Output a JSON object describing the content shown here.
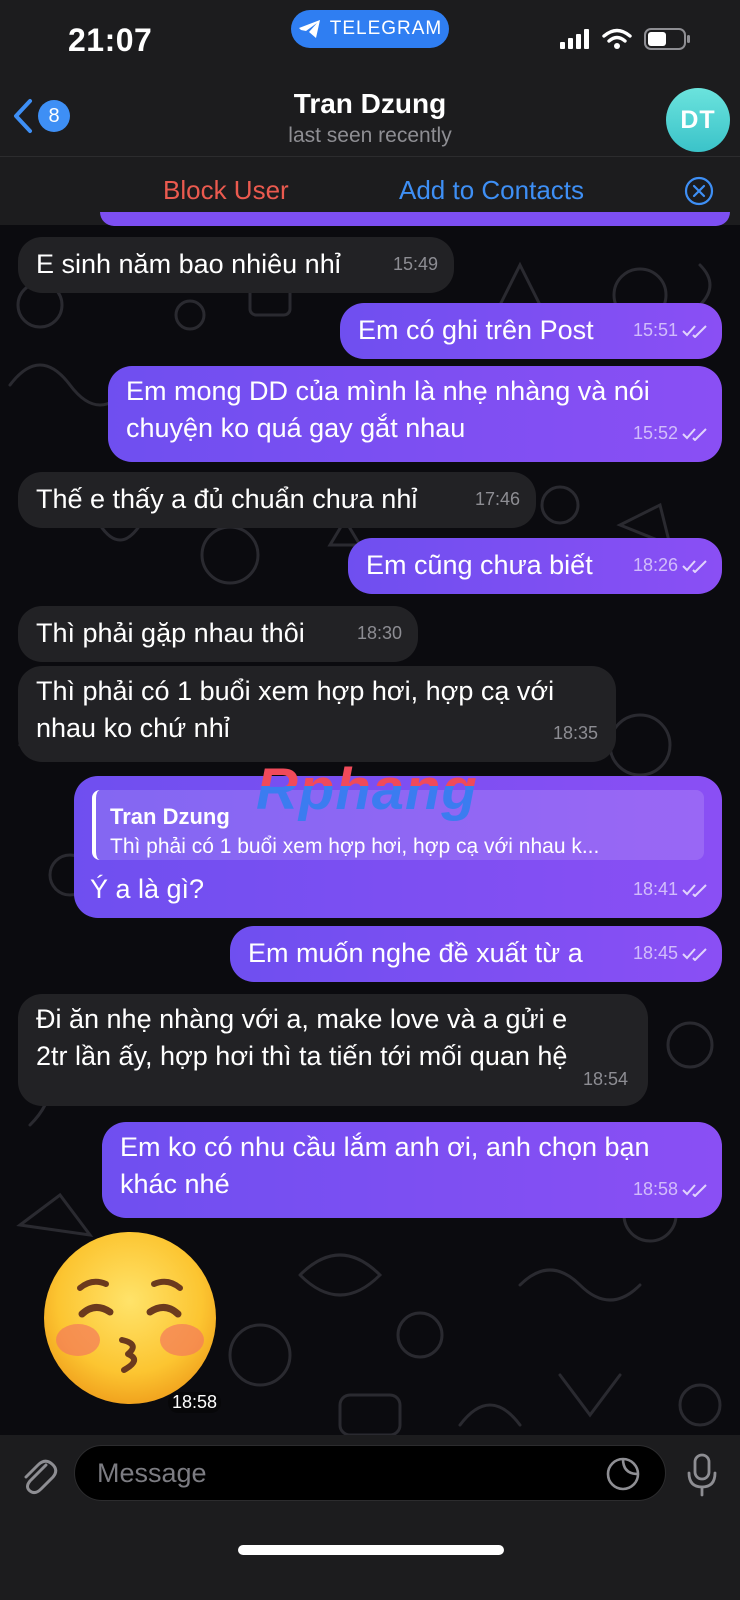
{
  "status_bar": {
    "time": "21:07",
    "pill_label": "TELEGRAM"
  },
  "header": {
    "back_badge": "8",
    "title": "Tran Dzung",
    "subtitle": "last seen recently",
    "avatar_initials": "DT"
  },
  "action_bar": {
    "block_label": "Block User",
    "add_label": "Add to Contacts"
  },
  "messages": [
    {
      "dir": "in",
      "lines": [
        "E sinh năm bao nhiêu nhỉ"
      ],
      "time": "15:49"
    },
    {
      "dir": "out",
      "lines": [
        "Em có ghi trên Post"
      ],
      "time": "15:51"
    },
    {
      "dir": "out",
      "lines": [
        "Em mong DD của mình là nhẹ nhàng và nói",
        "chuyện ko quá gay gắt nhau"
      ],
      "time": "15:52"
    },
    {
      "dir": "in",
      "lines": [
        "Thế e thấy a đủ chuẩn chưa nhỉ"
      ],
      "time": "17:46"
    },
    {
      "dir": "out",
      "lines": [
        "Em cũng chưa biết"
      ],
      "time": "18:26"
    },
    {
      "dir": "in",
      "lines": [
        "Thì phải gặp nhau thôi"
      ],
      "time": "18:30"
    },
    {
      "dir": "in",
      "lines": [
        "Thì phải có 1 buổi xem hợp hơi, hợp cạ với",
        "nhau ko chứ nhỉ"
      ],
      "time": "18:35"
    },
    {
      "dir": "out",
      "reply_name": "Tran Dzung",
      "reply_text": "Thì phải có 1 buổi xem hợp hơi, hợp cạ với nhau k...",
      "lines": [
        "Ý a là gì?"
      ],
      "time": "18:41"
    },
    {
      "dir": "out",
      "lines": [
        "Em muốn nghe đề xuất từ a"
      ],
      "time": "18:45"
    },
    {
      "dir": "in",
      "lines": [
        "Đi ăn nhẹ nhàng với a, make love và a gửi e",
        "2tr lần ấy, hợp hơi thì ta tiến tới mối quan hệ"
      ],
      "time": "18:54"
    },
    {
      "dir": "out",
      "lines": [
        "Em ko có nhu cầu lắm anh ơi, anh chọn bạn",
        "khác nhé"
      ],
      "time": "18:58"
    }
  ],
  "sticker": {
    "time": "18:58"
  },
  "watermark": "Rphang",
  "input": {
    "placeholder": "Message"
  }
}
